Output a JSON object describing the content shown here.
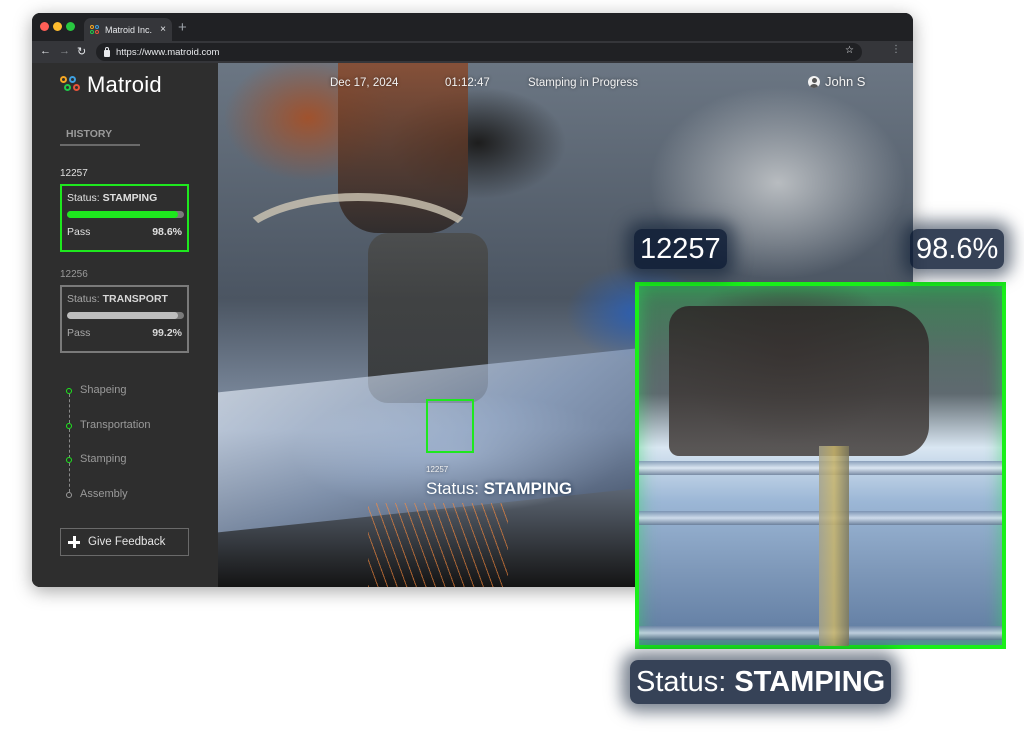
{
  "browser": {
    "tab_title": "Matroid Inc.",
    "tab_close": "×",
    "new_tab": "+",
    "url": "https://www.matroid.com",
    "back_glyph": "←",
    "forward_glyph": "→",
    "reload_glyph": "↻",
    "star_glyph": "☆",
    "menu_glyph": "⋮"
  },
  "app": {
    "logo_text": "Matroid",
    "brand_colors": [
      "#f5a623",
      "#3fa0e0",
      "#1ec94b",
      "#e8543a"
    ],
    "accent": "#1ee81e"
  },
  "sidebar": {
    "history_label": "HISTORY",
    "cards": [
      {
        "id": "12257",
        "status_prefix": "Status: ",
        "status": "STAMPING",
        "progress": 0.95,
        "pass_label": "Pass",
        "pass_value": "98.6%",
        "active": true,
        "bar_color": "#1ee81e"
      },
      {
        "id": "12256",
        "status_prefix": "Status: ",
        "status": "TRANSPORT",
        "progress": 0.95,
        "pass_label": "Pass",
        "pass_value": "99.2%",
        "active": false,
        "bar_color": "#bdbdbd"
      }
    ],
    "steps": [
      {
        "label": "Shapeing",
        "done": true
      },
      {
        "label": "Transportation",
        "done": true
      },
      {
        "label": "Stamping",
        "done": true
      },
      {
        "label": "Assembly",
        "done": false
      }
    ],
    "feedback_label": "Give Feedback"
  },
  "video": {
    "date": "Dec 17, 2024",
    "time": "01:12:47",
    "status_text": "Stamping in Progress",
    "user_name": "John S",
    "detection": {
      "id": "12257",
      "status_prefix": "Status: ",
      "status": "STAMPING"
    }
  },
  "overlay": {
    "id": "12257",
    "pass_value": "98.6%",
    "status_prefix": "Status: ",
    "status": "STAMPING"
  }
}
